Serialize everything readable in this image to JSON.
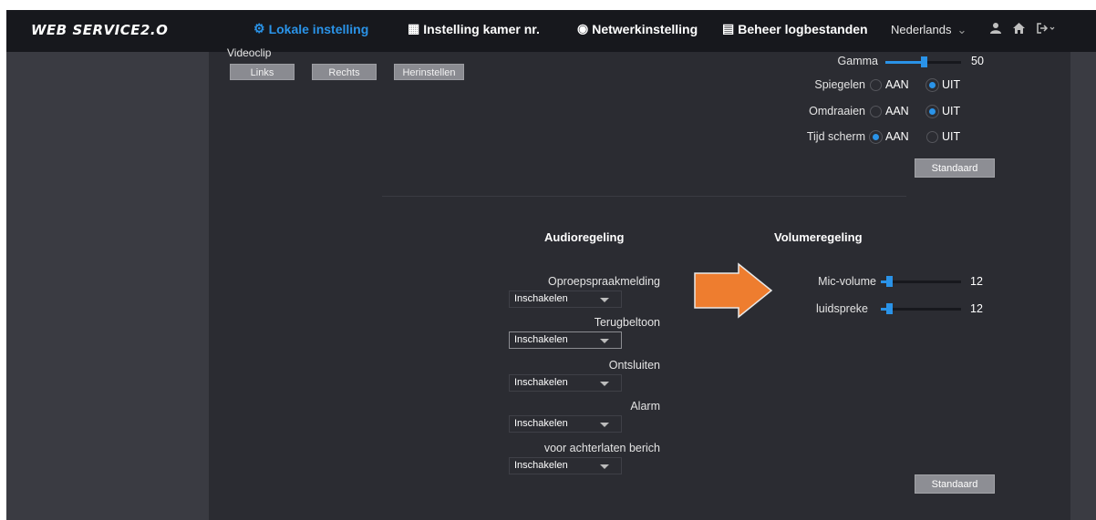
{
  "header": {
    "logo": "WEB SERVICE2.O",
    "tabs": [
      {
        "label": "Lokale instelling",
        "icon": "gear-icon",
        "active": true
      },
      {
        "label": "Instelling kamer nr.",
        "icon": "building-icon",
        "active": false
      },
      {
        "label": "Netwerkinstelling",
        "icon": "globe-icon",
        "active": false
      },
      {
        "label": "Beheer logbestanden",
        "icon": "document-icon",
        "active": false
      }
    ],
    "language": "Nederlands",
    "icons": [
      "user-icon",
      "home-icon",
      "logout-icon"
    ]
  },
  "video": {
    "section_label": "Videoclip",
    "buttons": {
      "links": "Links",
      "rechts": "Rechts",
      "reset": "Herinstellen"
    },
    "gamma": {
      "label": "Gamma",
      "value": "50",
      "level_fraction": 0.5
    },
    "mirror": {
      "label": "Spiegelen",
      "on": "AAN",
      "off": "UIT",
      "selected": "UIT"
    },
    "flip": {
      "label": "Omdraaien",
      "on": "AAN",
      "off": "UIT",
      "selected": "UIT"
    },
    "time_screen": {
      "label": "Tijd scherm",
      "on": "AAN",
      "off": "UIT",
      "selected": "AAN"
    },
    "default_button": "Standaard"
  },
  "audio": {
    "title": "Audioregeling",
    "items": [
      {
        "label": "Oproepspraakmelding",
        "value": "Inschakelen"
      },
      {
        "label": "Terugbeltoon",
        "value": "Inschakelen"
      },
      {
        "label": "Ontsluiten",
        "value": "Inschakelen"
      },
      {
        "label": "Alarm",
        "value": "Inschakelen"
      },
      {
        "label": "voor achterlaten berich",
        "value": "Inschakelen"
      }
    ]
  },
  "volume": {
    "title": "Volumeregeling",
    "mic": {
      "label": "Mic-volume",
      "value": "12"
    },
    "speaker": {
      "label": "luidspreke",
      "value": "12"
    },
    "default_button": "Standaard"
  },
  "colors": {
    "accent": "#2a93e8",
    "arrow": "#ee7d2f",
    "panel": "#2b2c32",
    "topbar": "#17181d"
  }
}
